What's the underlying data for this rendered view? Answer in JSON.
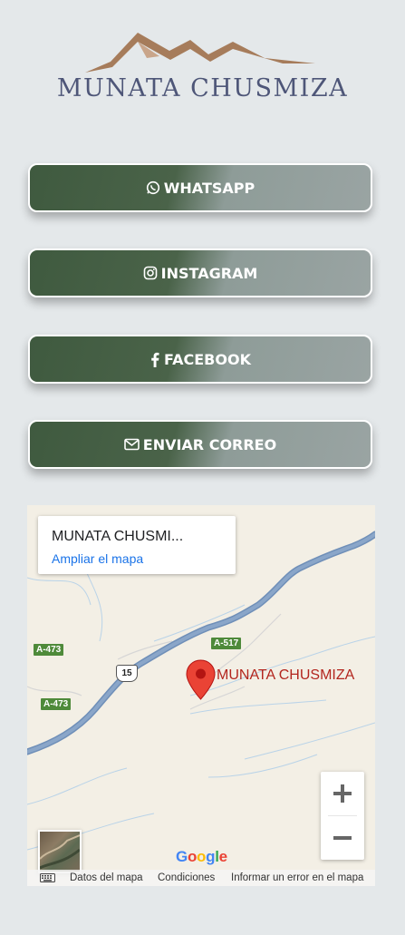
{
  "brand": {
    "name": "MUNATA CHUSMIZA",
    "logo_color": "#a67c5b",
    "text_color": "#4e5678"
  },
  "buttons": [
    {
      "label": "WHATSAPP",
      "icon": "whatsapp-icon"
    },
    {
      "label": "INSTAGRAM",
      "icon": "instagram-icon"
    },
    {
      "label": "FACEBOOK",
      "icon": "facebook-icon"
    },
    {
      "label": "ENVIAR CORREO",
      "icon": "envelope-icon"
    }
  ],
  "map": {
    "place_title": "MUNATA CHUSMI...",
    "enlarge_link": "Ampliar el mapa",
    "marker_label": "MUNATA CHUSMIZA",
    "road_labels": [
      "A-473",
      "A-517",
      "A-473"
    ],
    "route_shield": "15",
    "zoom_in": "+",
    "zoom_out": "−",
    "attribution": "Google",
    "footer": {
      "map_data": "Datos del mapa",
      "terms": "Condiciones",
      "report": "Informar un error en el mapa"
    }
  }
}
